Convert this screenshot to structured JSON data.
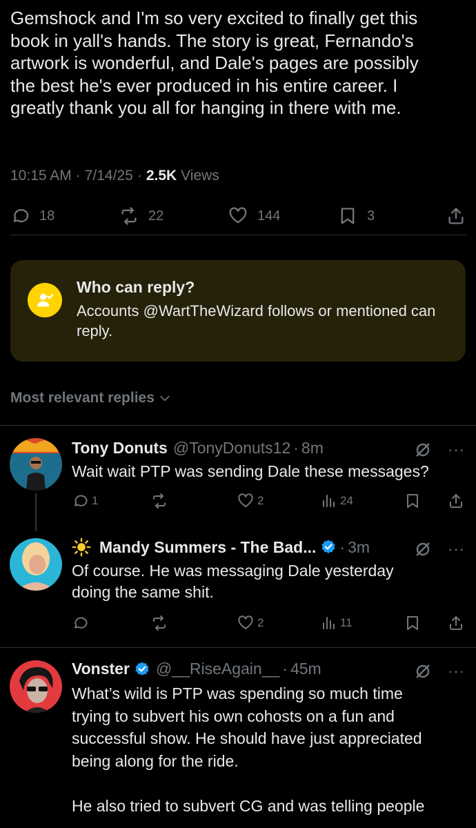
{
  "post": {
    "body": "Gemshock and I'm so very excited to finally get this\nbook in yall's hands. The story is great, Fernando's\nartwork is wonderful, and Dale's pages are possibly\nthe best he's ever produced in his entire career. I\ngreatly thank you all for hanging in there with me.",
    "time": "10:15 AM",
    "date": "7/14/25",
    "views_count": "2.5K",
    "views_label": "Views",
    "replies": "18",
    "reposts": "22",
    "likes": "144",
    "bookmarks": "3"
  },
  "reply_restriction": {
    "title": "Who can reply?",
    "text": "Accounts @WartTheWizard follows or mentioned can reply."
  },
  "replies_section": {
    "label": "Most relevant replies"
  },
  "replies": [
    {
      "name": "Tony Donuts",
      "handle": "@TonyDonuts12",
      "time": "8m",
      "text": "Wait wait PTP was sending Dale these messages?",
      "reply_count": "1",
      "repost_count": "",
      "like_count": "2",
      "view_count": "24"
    },
    {
      "name": "Mandy Summers - The Bad...",
      "handle": "",
      "time": "3m",
      "text": "Of course. He was messaging Dale yesterday\ndoing the same shit.",
      "reply_count": "",
      "repost_count": "",
      "like_count": "2",
      "view_count": "11"
    },
    {
      "name": "Vonster",
      "handle": "@__RiseAgain__",
      "time": "45m",
      "text": "What’s wild is PTP was spending so much time\ntrying to subvert his own cohosts on a fun and\nsuccessful show. He should have just appreciated\nbeing along for the ride.\n\nHe also tried to subvert CG and was telling people"
    }
  ],
  "colors": {
    "background": "#000000",
    "text": "#e7e9ea",
    "muted": "#71767b",
    "verified": "#1d9bf0",
    "badge": "#ffd400",
    "reply_box_bg": "#262109"
  },
  "icons": {
    "reply": "reply-icon",
    "repost": "repost-icon",
    "like": "heart-icon",
    "bookmark": "bookmark-icon",
    "share": "share-icon",
    "views": "views-icon",
    "grok": "grok-icon",
    "more": "more-icon",
    "verified": "verified-badge-icon",
    "sun": "sun-emoji-icon"
  }
}
